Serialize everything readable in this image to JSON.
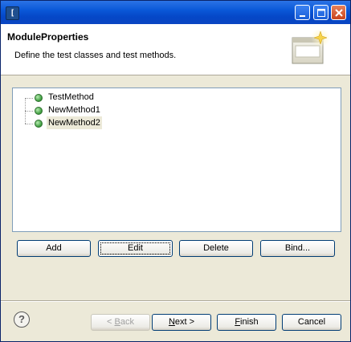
{
  "window": {
    "app_icon": "eclipse-app-icon",
    "app_icon_glyph": "[",
    "controls": [
      "minimize-icon",
      "maximize-icon",
      "close-icon"
    ]
  },
  "header": {
    "title": "ModuleProperties",
    "description": "Define the test classes and test methods.",
    "icon": "wizard-banner-icon"
  },
  "tree": {
    "items": [
      {
        "label": "TestMethod",
        "selected": false
      },
      {
        "label": "NewMethod1",
        "selected": false
      },
      {
        "label": "NewMethod2",
        "selected": true
      }
    ]
  },
  "actions": {
    "add": "Add",
    "edit": "Edit",
    "delete": "Delete",
    "bind": "Bind..."
  },
  "footer": {
    "help_glyph": "?",
    "back_prefix": "< ",
    "back_mnemonic": "B",
    "back_rest": "ack",
    "next_mnemonic": "N",
    "next_rest": "ext >",
    "finish_mnemonic": "F",
    "finish_rest": "inish",
    "cancel": "Cancel"
  }
}
